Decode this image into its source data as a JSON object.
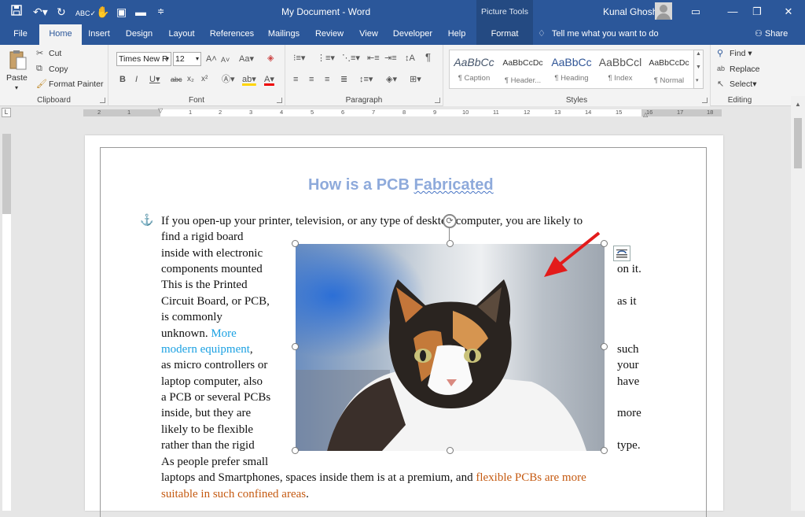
{
  "window": {
    "doc_title": "My Document - Word",
    "picture_tools": "Picture Tools",
    "user_name": "Kunal Ghosh",
    "minimize": "—",
    "restore": "❐",
    "close": "✕",
    "ribbon_display": "▭"
  },
  "tabs": [
    "File",
    "Home",
    "Insert",
    "Design",
    "Layout",
    "References",
    "Mailings",
    "Review",
    "View",
    "Developer",
    "Help",
    "Format"
  ],
  "tell_me": "Tell me what you want to do",
  "share": "Share",
  "clipboard": {
    "paste": "Paste",
    "cut": "Cut",
    "copy": "Copy",
    "format_painter": "Format Painter",
    "label": "Clipboard"
  },
  "font": {
    "name": "Times New R",
    "size": "12",
    "label": "Font"
  },
  "paragraph": {
    "label": "Paragraph"
  },
  "styles": {
    "label": "Styles",
    "items": [
      {
        "preview": "AaBbCc",
        "name": "¶ Caption"
      },
      {
        "preview": "AaBbCcDc",
        "name": "¶ Header..."
      },
      {
        "preview": "AaBbCc",
        "name": "¶ Heading"
      },
      {
        "preview": "AaBbCcl",
        "name": "¶ Index"
      },
      {
        "preview": "AaBbCcDc",
        "name": "¶ Normal"
      }
    ]
  },
  "editing": {
    "find": "Find",
    "replace": "Replace",
    "select": "Select",
    "label": "Editing"
  },
  "ruler": {
    "corner": "L",
    "numbers": [
      "2",
      "1",
      "1",
      "2",
      "3",
      "4",
      "5",
      "6",
      "7",
      "8",
      "9",
      "10",
      "11",
      "12",
      "13",
      "14",
      "15",
      "16",
      "17",
      "18"
    ]
  },
  "document": {
    "heading_pre": "How is a PCB ",
    "heading_word": "Fabricated",
    "lines": {
      "l1": "If you open-up your printer, television, or any type of desktop computer, you are likely to",
      "l2": "find a rigid board",
      "l3": "inside with electronic",
      "l4": "components mounted",
      "l4r": "on it.",
      "l5": "This is the Printed",
      "l6": "Circuit Board, or PCB,",
      "l6r": "as it",
      "l7": "is commonly",
      "l8a": "unknown.",
      "l8b": "More",
      "l9a": "modern equipment",
      "l9b": ",",
      "l9r": "such",
      "l10": "as micro controllers or",
      "l10r": "your",
      "l11": "laptop computer, also",
      "l11r": "have",
      "l12": "a PCB or several PCBs",
      "l13": "inside, but they are",
      "l13r": "more",
      "l14": "likely to be flexible",
      "l15": "rather than the rigid",
      "l15r": "type.",
      "l16": "As people prefer small",
      "l17a": "laptops and Smartphones, spaces inside them is at a premium, and ",
      "l17b": "flexible PCBs are more",
      "l18a": "suitable in such confined areas",
      "l18b": "."
    }
  },
  "colors": {
    "word_blue": "#2b579a",
    "heading": "#8eaadb",
    "link_blue": "#1ca1e2",
    "orange": "#c55a11",
    "arrow_red": "#e31b1b"
  }
}
